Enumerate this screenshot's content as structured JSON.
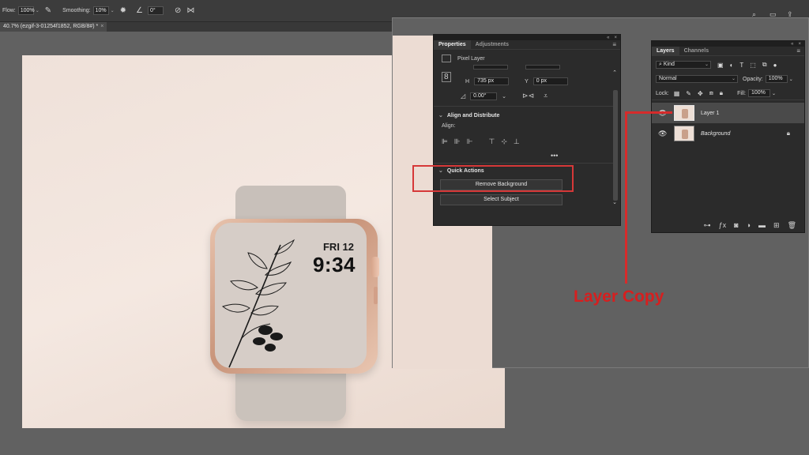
{
  "toolbar": {
    "flow_label": "Flow:",
    "flow_value": "100%",
    "smoothing_label": "Smoothing:",
    "smoothing_value": "10%",
    "angle_value": "0°"
  },
  "document": {
    "tab_title": "40.7% (ezgif-3-01254f1852, RGB/8#) *",
    "close": "×"
  },
  "watch_face": {
    "date": "FRI 12",
    "time": "9:34"
  },
  "properties": {
    "tabs": [
      "Properties",
      "Adjustments"
    ],
    "layer_type": "Pixel Layer",
    "h_label": "H",
    "h_value": "735 px",
    "y_label": "Y",
    "y_value": "0 px",
    "angle_value": "0.00°",
    "align_section": "Align and Distribute",
    "align_label": "Align:",
    "more": "•••",
    "quick_actions": "Quick Actions",
    "remove_bg": "Remove Background",
    "select_subject": "Select Subject"
  },
  "layers": {
    "tabs": [
      "Layers",
      "Channels"
    ],
    "kind": "Kind",
    "blend_mode": "Normal",
    "opacity_label": "Opacity:",
    "opacity_value": "100%",
    "lock_label": "Lock:",
    "fill_label": "Fill:",
    "fill_value": "100%",
    "items": [
      {
        "name": "Layer 1"
      },
      {
        "name": "Background"
      }
    ]
  },
  "annotation": {
    "text": "Layer Copy",
    "color": "#d61f1f"
  }
}
